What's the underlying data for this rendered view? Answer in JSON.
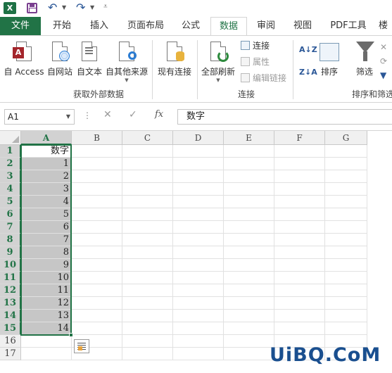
{
  "quick_access": {
    "app_icon_letter": "X",
    "icons": [
      "excel-icon",
      "save-icon",
      "undo-icon",
      "redo-icon",
      "customize-icon"
    ]
  },
  "tabs": {
    "file": "文件",
    "items": [
      {
        "label": "开始"
      },
      {
        "label": "插入"
      },
      {
        "label": "页面布局"
      },
      {
        "label": "公式"
      },
      {
        "label": "数据",
        "active": true
      },
      {
        "label": "审阅"
      },
      {
        "label": "视图"
      },
      {
        "label": "PDF工具"
      },
      {
        "label": "楼"
      }
    ]
  },
  "ribbon": {
    "get_external": {
      "label": "获取外部数据",
      "buttons": [
        {
          "label": "自 Access"
        },
        {
          "label": "自网站"
        },
        {
          "label": "自文本"
        },
        {
          "label": "自其他来源"
        },
        {
          "label": "现有连接"
        }
      ]
    },
    "connections": {
      "label": "连接",
      "refresh_all": "全部刷新",
      "small": [
        {
          "label": "连接",
          "enabled": true
        },
        {
          "label": "属性",
          "enabled": false
        },
        {
          "label": "编辑链接",
          "enabled": false
        }
      ]
    },
    "sort_filter": {
      "label": "排序和筛选",
      "sort_az": "A↓Z",
      "sort_za": "Z↓A",
      "sort": "排序",
      "filter": "筛选"
    }
  },
  "formula_bar": {
    "name_box": "A1",
    "cancel_glyph": "✕",
    "enter_glyph": "✓",
    "fx_label": "fx",
    "value": "数字"
  },
  "sheet": {
    "columns": [
      "A",
      "B",
      "C",
      "D",
      "E",
      "F",
      "G"
    ],
    "rows": [
      "1",
      "2",
      "3",
      "4",
      "5",
      "6",
      "7",
      "8",
      "9",
      "10",
      "11",
      "12",
      "13",
      "14",
      "15",
      "16",
      "17"
    ],
    "column_a_values": [
      "数字",
      "1",
      "2",
      "3",
      "4",
      "5",
      "6",
      "7",
      "8",
      "9",
      "10",
      "11",
      "12",
      "13",
      "14"
    ],
    "selected_range": "A1:A15",
    "accent_color": "#217346"
  },
  "watermark": "UiBQ.CoM"
}
